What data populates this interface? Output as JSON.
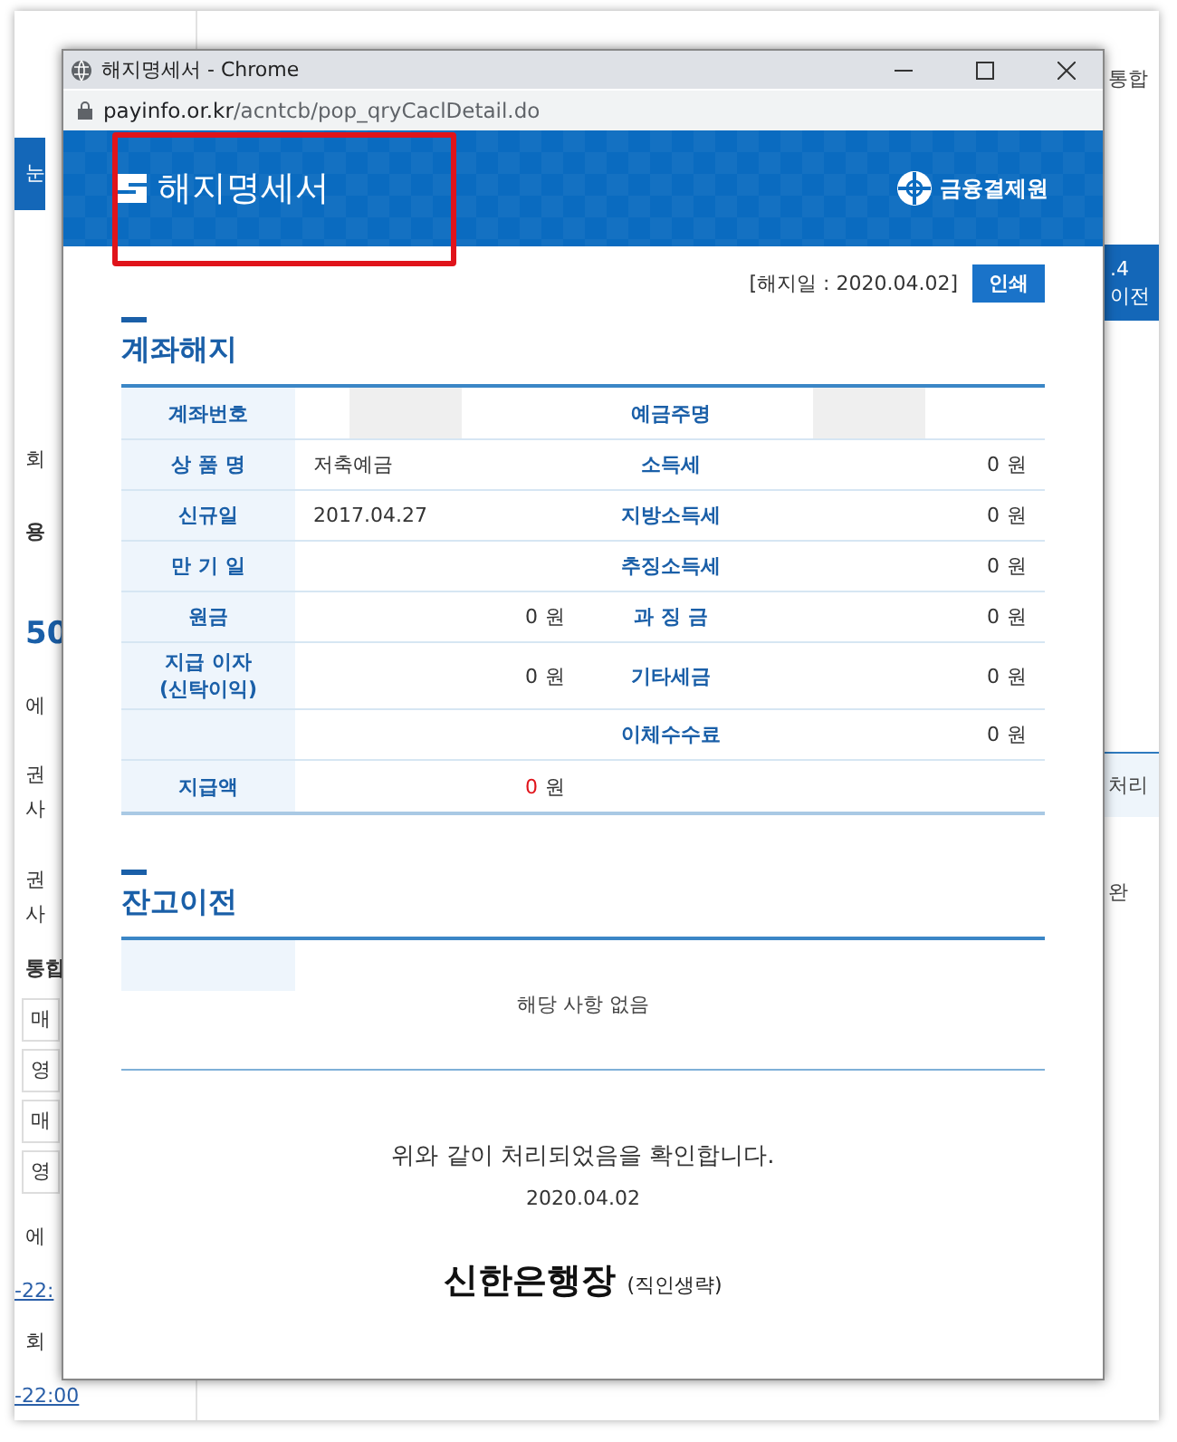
{
  "background_page": {
    "left_fragments": [
      {
        "kind": "block",
        "text": "눈"
      },
      {
        "kind": "text",
        "text": "회"
      },
      {
        "kind": "heading",
        "text": "용"
      },
      {
        "kind": "number",
        "text": "50"
      },
      {
        "kind": "text",
        "text": "에"
      },
      {
        "kind": "text",
        "text": "권"
      },
      {
        "kind": "text",
        "text": "사"
      },
      {
        "kind": "text",
        "text": "권"
      },
      {
        "kind": "text",
        "text": "사"
      },
      {
        "kind": "heading",
        "text": "통합"
      },
      {
        "kind": "cell",
        "text": "매"
      },
      {
        "kind": "cell",
        "text": "영"
      },
      {
        "kind": "cell",
        "text": "매"
      },
      {
        "kind": "cell",
        "text": "영"
      },
      {
        "kind": "text",
        "text": "에"
      },
      {
        "kind": "link",
        "text": "-22:"
      },
      {
        "kind": "text",
        "text": "회"
      },
      {
        "kind": "link",
        "text": "-22:00"
      }
    ],
    "right_fragments": [
      {
        "kind": "text",
        "lines": [
          "통합"
        ]
      },
      {
        "kind": "block",
        "lines": [
          ".4",
          "이전"
        ]
      },
      {
        "kind": "header",
        "lines": [
          "처리"
        ]
      },
      {
        "kind": "text",
        "lines": [
          "완"
        ]
      }
    ]
  },
  "popup": {
    "window_title": "해지명세서 - Chrome",
    "url_host": "payinfo.or.kr",
    "url_path": "/acntcb/pop_qryCaclDetail.do",
    "header": {
      "title": "해지명세서",
      "org": "금융결제원"
    },
    "termination_date": "[해지일 : 2020.04.02]",
    "print_button": "인쇄",
    "account_section": {
      "title": "계좌해지",
      "rows": [
        {
          "label": "계좌번호",
          "value": {
            "redacted": true
          },
          "label2": "예금주명",
          "value2": {
            "redacted": true
          }
        },
        {
          "label": "상 품 명",
          "value": {
            "text": "저축예금"
          },
          "label2": "소득세",
          "value2": {
            "amount": "0",
            "unit": "원"
          }
        },
        {
          "label": "신규일",
          "value": {
            "text": "2017.04.27"
          },
          "label2": "지방소득세",
          "value2": {
            "amount": "0",
            "unit": "원"
          }
        },
        {
          "label": "만 기 일",
          "value": {},
          "label2": "추징소득세",
          "value2": {
            "amount": "0",
            "unit": "원"
          }
        },
        {
          "label": "원금",
          "value": {
            "amount": "0",
            "unit": "원"
          },
          "label2": "과 징 금",
          "value2": {
            "amount": "0",
            "unit": "원"
          }
        },
        {
          "label": "지급 이자\n(신탁이익)",
          "value": {
            "amount": "0",
            "unit": "원"
          },
          "label2": "기타세금",
          "value2": {
            "amount": "0",
            "unit": "원"
          }
        },
        {
          "label": "",
          "value": {},
          "label2": "이체수수료",
          "value2": {
            "amount": "0",
            "unit": "원"
          }
        },
        {
          "label": "지급액",
          "value": {
            "amount": "0",
            "unit": "원",
            "emphasis": true
          },
          "label2": "",
          "value2": {}
        }
      ]
    },
    "balance_section": {
      "title": "잔고이전",
      "empty_message": "해당 사항 없음"
    },
    "confirmation": "위와 같이 처리되었음을 확인합니다.",
    "confirmation_date": "2020.04.02",
    "signer": "신한은행장",
    "signer_note": "(직인생략)"
  },
  "annotation": {
    "highlight_title": true
  }
}
